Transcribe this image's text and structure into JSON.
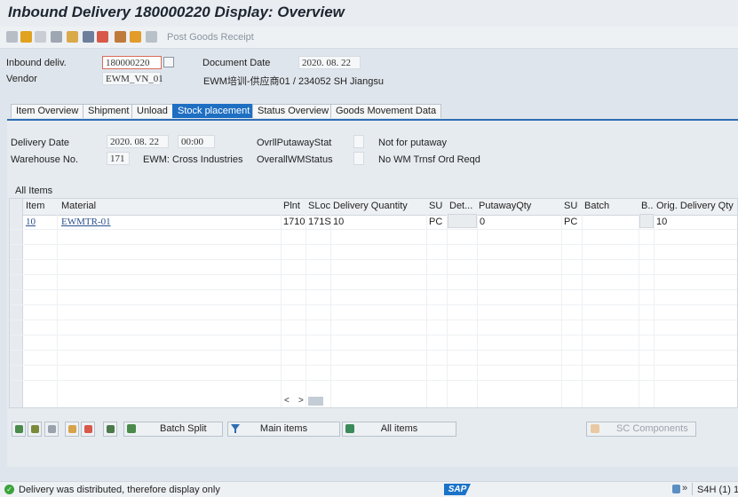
{
  "window": {
    "title": "Inbound Delivery 180000220 Display: Overview"
  },
  "toolbar": {
    "post_goods_receipt": "Post Goods Receipt"
  },
  "header": {
    "inbound_deliv_label": "Inbound deliv.",
    "inbound_deliv_value": "180000220",
    "document_date_label": "Document Date",
    "document_date_value": "2020. 08. 22",
    "vendor_label": "Vendor",
    "vendor_value": "EWM_VN_01",
    "vendor_desc": "EWM培训-供应商01 / 234052 SH Jiangsu"
  },
  "tabs": [
    {
      "label": "Item Overview"
    },
    {
      "label": "Shipment"
    },
    {
      "label": "Unload"
    },
    {
      "label": "Stock placement",
      "active": true
    },
    {
      "label": "Status Overview"
    },
    {
      "label": "Goods Movement Data"
    }
  ],
  "stock": {
    "delivery_date_label": "Delivery Date",
    "delivery_date_value": "2020. 08. 22",
    "delivery_time_value": "00:00",
    "ovrll_putaway_label": "OvrllPutawayStat",
    "ovrll_putaway_text": "Not for putaway",
    "warehouse_label": "Warehouse No.",
    "warehouse_value": "171",
    "warehouse_desc": "EWM: Cross Industries",
    "overall_wm_label": "OverallWMStatus",
    "overall_wm_text": "No WM Trnsf Ord Reqd"
  },
  "items": {
    "section_label": "All Items",
    "columns": [
      "Item",
      "Material",
      "Plnt",
      "SLoc",
      "Delivery Quantity",
      "SU",
      "Det...",
      "PutawayQty",
      "SU",
      "Batch",
      "B..",
      "Orig. Delivery Qty"
    ],
    "rows": [
      {
        "item": "10",
        "material": "EWMTR-01",
        "plnt": "1710",
        "sloc": "171S",
        "delivery_qty": "10",
        "su": "PC",
        "putaway_qty": "0",
        "su2": "PC",
        "orig_qty": "10"
      }
    ]
  },
  "buttons": {
    "batch_split": "Batch Split",
    "main_items": "Main items",
    "all_items": "All items",
    "sc_components": "SC Components"
  },
  "status": {
    "message": "Delivery was distributed, therefore display only",
    "system": "S4H (1) 1",
    "logo": "SAP",
    "ok_color": "#3aa33a"
  }
}
